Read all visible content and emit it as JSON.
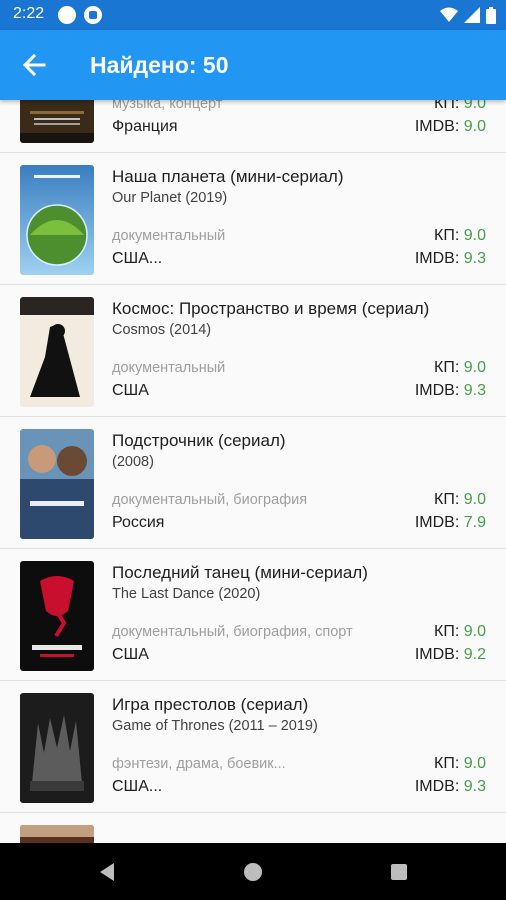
{
  "status_bar": {
    "time": "2:22"
  },
  "app_bar": {
    "title": "Найдено: 50"
  },
  "labels": {
    "kp": "КП:",
    "imdb": "IMDB:"
  },
  "colors": {
    "app_bar": "#2196f3",
    "status_bar": "#1976d2",
    "rating": "#43a047"
  },
  "icons": {
    "back": "arrow-left-icon",
    "nav_back": "triangle-back-icon",
    "nav_home": "circle-home-icon",
    "nav_recents": "square-recents-icon"
  },
  "items": [
    {
      "title": "",
      "subtitle": "",
      "genre": "музыка, концерт",
      "country": "Франция",
      "kp": "9.0",
      "imdb": "9.0"
    },
    {
      "title": "Наша планета (мини-сериал)",
      "subtitle": "Our Planet (2019)",
      "genre": "документальный",
      "country": "США...",
      "kp": "9.0",
      "imdb": "9.3"
    },
    {
      "title": "Космос: Пространство и время (сериал)",
      "subtitle": "Cosmos (2014)",
      "genre": "документальный",
      "country": "США",
      "kp": "9.0",
      "imdb": "9.3"
    },
    {
      "title": "Подстрочник (сериал)",
      "subtitle": "(2008)",
      "genre": "документальный, биография",
      "country": "Россия",
      "kp": "9.0",
      "imdb": "7.9"
    },
    {
      "title": "Последний танец (мини-сериал)",
      "subtitle": "The Last Dance (2020)",
      "genre": "документальный, биография, спорт",
      "country": "США",
      "kp": "9.0",
      "imdb": "9.2"
    },
    {
      "title": "Игра престолов (сериал)",
      "subtitle": "Game of Thrones (2011 – 2019)",
      "genre": "фэнтези, драма, боевик...",
      "country": "США...",
      "kp": "9.0",
      "imdb": "9.3"
    }
  ]
}
